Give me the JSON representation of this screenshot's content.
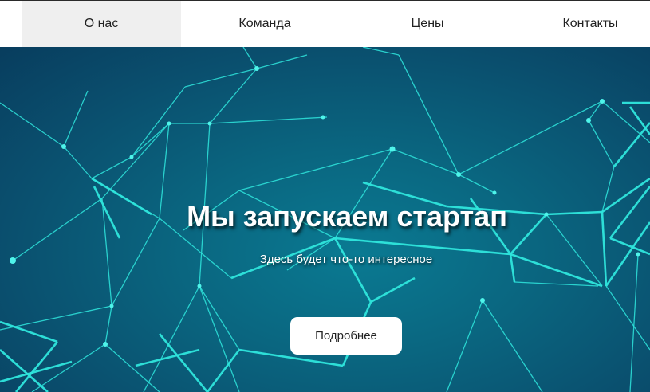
{
  "nav": {
    "items": [
      {
        "label": "О нас",
        "active": true
      },
      {
        "label": "Команда",
        "active": false
      },
      {
        "label": "Цены",
        "active": false
      },
      {
        "label": "Контакты",
        "active": false
      }
    ]
  },
  "hero": {
    "title": "Мы запускаем стартап",
    "subtitle": "Здесь будет что-то интересное",
    "button_label": "Подробнее",
    "background_image": "network-lines-image"
  },
  "colors": {
    "nav_active_bg": "#efefef",
    "hero_bg": "#0a6680",
    "network_line": "#2fe6dd",
    "button_bg": "#ffffff"
  }
}
